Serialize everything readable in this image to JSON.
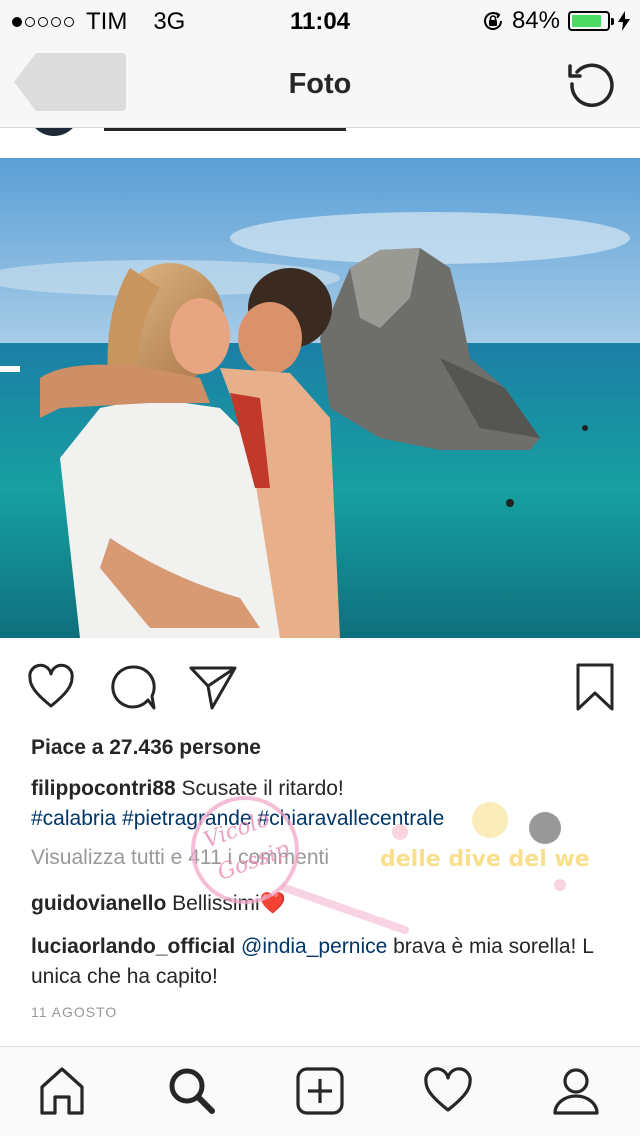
{
  "status_bar": {
    "signal_dots": 5,
    "signal_filled": 1,
    "carrier": "TIM",
    "network": "3G",
    "time": "11:04",
    "battery_percent": "84%",
    "battery_level": 0.84,
    "icons": [
      "rotation-lock-icon",
      "battery-icon",
      "charging-bolt-icon"
    ]
  },
  "nav": {
    "title": "Foto",
    "icons": [
      "back-icon",
      "refresh-icon"
    ]
  },
  "post": {
    "photo_alt": "couple-kissing-by-sea-rock",
    "likes_text": "Piace a 27.436 persone",
    "caption": {
      "username": "filippocontri88",
      "text": " Scusate il ritardo!",
      "hashtags": "#calabria #pietragrande #chiaravallecentrale"
    },
    "view_all_comments": "Visualizza tutti e 411 i commenti",
    "comments": [
      {
        "username": "guidovianello",
        "text": " Bellissimi",
        "emoji": "❤️"
      },
      {
        "username": "luciaorlando_official",
        "mention": " @india_pernice",
        "text": " brava  è mia sorella! L unica che ha capito!"
      }
    ],
    "date": "11 AGOSTO",
    "action_icons": [
      "heart-icon",
      "comment-icon",
      "share-icon",
      "bookmark-icon"
    ]
  },
  "watermark_lines": [
    "Vicolo",
    "Gossip",
    "delle",
    "dive del web"
  ],
  "tab_bar": {
    "icons": [
      "home-icon",
      "search-icon",
      "add-icon",
      "activity-heart-icon",
      "profile-icon"
    ]
  },
  "colors": {
    "link": "#003569",
    "muted": "#999999",
    "text": "#262626",
    "battery_fill": "#4cd964"
  }
}
